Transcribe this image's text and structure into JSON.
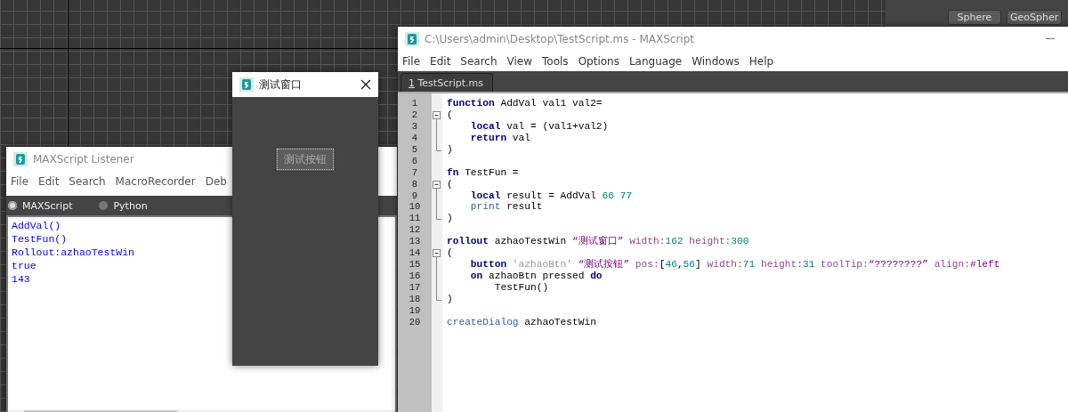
{
  "command_panel": {
    "buttons": [
      "Sphere",
      "GeoSpher"
    ]
  },
  "listener": {
    "title": "MAXScript Listener",
    "menu": [
      "File",
      "Edit",
      "Search",
      "MacroRecorder",
      "Deb"
    ],
    "languages": [
      {
        "label": "MAXScript",
        "selected": true
      },
      {
        "label": "Python",
        "selected": false
      }
    ],
    "output": [
      "AddVal()",
      "TestFun()",
      "Rollout:azhaoTestWin",
      "true",
      "143"
    ]
  },
  "dialog": {
    "title": "测试窗口",
    "button": "测试按钮"
  },
  "editor": {
    "title": "C:\\Users\\admin\\Desktop\\TestScript.ms - MAXScript",
    "menu": [
      "File",
      "Edit",
      "Search",
      "View",
      "Tools",
      "Options",
      "Language",
      "Windows",
      "Help"
    ],
    "tabs": [
      {
        "mnemonic": "1",
        "label": "TestScript.ms",
        "selected": true
      }
    ],
    "lines": [
      {
        "number": "1",
        "tokens": [
          {
            "kind": "kw",
            "text": "function"
          },
          {
            "kind": "plain",
            "text": " AddVal val1 val2="
          }
        ]
      },
      {
        "number": "2",
        "fold_open": true,
        "tokens": [
          {
            "kind": "plain",
            "text": "("
          }
        ]
      },
      {
        "number": "3",
        "in_fold": true,
        "tokens": [
          {
            "kind": "kw",
            "text": "    local"
          },
          {
            "kind": "plain",
            "text": " val = (val1+val2)"
          }
        ]
      },
      {
        "number": "4",
        "in_fold": true,
        "tokens": [
          {
            "kind": "kw",
            "text": "    return"
          },
          {
            "kind": "plain",
            "text": " val"
          }
        ]
      },
      {
        "number": "5",
        "fold_end": true,
        "tokens": [
          {
            "kind": "plain",
            "text": ")"
          }
        ]
      },
      {
        "number": "6"
      },
      {
        "number": "7",
        "tokens": [
          {
            "kind": "kw",
            "text": "fn"
          },
          {
            "kind": "plain",
            "text": " TestFun ="
          }
        ]
      },
      {
        "number": "8",
        "fold_open": true,
        "tokens": [
          {
            "kind": "plain",
            "text": "("
          }
        ]
      },
      {
        "number": "9",
        "in_fold": true,
        "tokens": [
          {
            "kind": "kw",
            "text": "    local"
          },
          {
            "kind": "plain",
            "text": " result = AddVal "
          },
          {
            "kind": "num",
            "text": "66 77"
          }
        ]
      },
      {
        "number": "10",
        "in_fold": true,
        "tokens": [
          {
            "kind": "fn",
            "text": "    print"
          },
          {
            "kind": "plain",
            "text": " result"
          }
        ]
      },
      {
        "number": "11",
        "fold_end": true,
        "tokens": [
          {
            "kind": "plain",
            "text": ")"
          }
        ]
      },
      {
        "number": "12"
      },
      {
        "number": "13",
        "tokens": [
          {
            "kind": "kw",
            "text": "rollout"
          },
          {
            "kind": "plain",
            "text": " azhaoTestWin "
          },
          {
            "kind": "str",
            "text": "“测试窗口”"
          },
          {
            "kind": "param",
            "text": " width:"
          },
          {
            "kind": "num",
            "text": "162"
          },
          {
            "kind": "param",
            "text": " height:"
          },
          {
            "kind": "num",
            "text": "300"
          }
        ]
      },
      {
        "number": "14",
        "fold_open": true,
        "tokens": [
          {
            "kind": "plain",
            "text": "("
          }
        ]
      },
      {
        "number": "15",
        "in_fold": true,
        "tokens": [
          {
            "kind": "kw",
            "text": "    button"
          },
          {
            "kind": "name",
            "text": " 'azhaoBtn'"
          },
          {
            "kind": "str",
            "text": " “测试按钮”"
          },
          {
            "kind": "param",
            "text": " pos:"
          },
          {
            "kind": "plain",
            "text": "["
          },
          {
            "kind": "num",
            "text": "46"
          },
          {
            "kind": "plain",
            "text": ","
          },
          {
            "kind": "num",
            "text": "56"
          },
          {
            "kind": "plain",
            "text": "]"
          },
          {
            "kind": "param",
            "text": " width:"
          },
          {
            "kind": "num",
            "text": "71"
          },
          {
            "kind": "param",
            "text": " height:"
          },
          {
            "kind": "num",
            "text": "31"
          },
          {
            "kind": "param",
            "text": " toolTip:"
          },
          {
            "kind": "str",
            "text": "“????????”"
          },
          {
            "kind": "param",
            "text": " align:"
          },
          {
            "kind": "str",
            "text": "#left"
          }
        ]
      },
      {
        "number": "16",
        "in_fold": true,
        "tokens": [
          {
            "kind": "kw",
            "text": "    on"
          },
          {
            "kind": "plain",
            "text": " azhaoBtn pressed "
          },
          {
            "kind": "kw",
            "text": "do"
          }
        ]
      },
      {
        "number": "17",
        "in_fold": true,
        "tokens": [
          {
            "kind": "plain",
            "text": "        TestFun()"
          }
        ]
      },
      {
        "number": "18",
        "fold_end": true,
        "tokens": [
          {
            "kind": "plain",
            "text": ")"
          }
        ]
      },
      {
        "number": "19"
      },
      {
        "number": "20",
        "tokens": [
          {
            "kind": "fn",
            "text": "createDialog"
          },
          {
            "kind": "plain",
            "text": " azhaoTestWin"
          }
        ]
      }
    ]
  }
}
